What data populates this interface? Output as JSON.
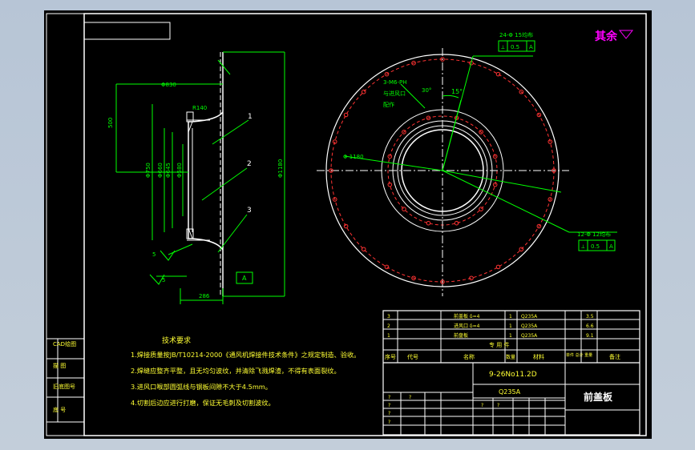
{
  "colors": {
    "background": "#b9c6d6",
    "paper": "#000000",
    "line": "#ffffff",
    "dimension": "#00ff00",
    "hole_red": "#ff3333",
    "title_text": "#ff00ff",
    "note_text": "#ffff00",
    "table_text": "#ffff33"
  },
  "drawing": {
    "roughness_corner": "其余",
    "flatness_callout_top": "24-Φ 15均布",
    "flatness_frame_top": [
      "⟂",
      "0.5",
      "A"
    ],
    "hole_callout": "3-M6-PH",
    "hole_callout_line2": "与进风口",
    "hole_callout_line3": "配作",
    "angle_label": "15°",
    "angle_label2": "30°",
    "circle_dim": "Φ 1180",
    "bottom_callout": "12-Φ 12均布",
    "bottom_frame": [
      "⟂",
      "0.5",
      "A"
    ]
  },
  "section_view": {
    "dims": {
      "d1": "Φ830",
      "d2": "R140",
      "d3": "500",
      "d4": "Φ750",
      "d5": "Φ660",
      "d6": "Φ645",
      "d7": "Φ580",
      "d8": "Φ1180",
      "d9": "5",
      "d10": "5",
      "d11": "286"
    },
    "balloons": [
      "1",
      "2",
      "3"
    ],
    "datum": "A"
  },
  "tech_notes": {
    "heading": "技术要求",
    "lines": [
      "1.焊接质量按JB/T10214-2000《通风机焊接件技术条件》之规定制造、验收。",
      "2.焊缝应整齐平整，且无均匀波纹，并清除飞溅焊渣，不得有表面裂纹。",
      "3.进风口喉部圆弧线与钢板间隙不大于4.5mm。",
      "4.切割后边应进行打磨，保证无毛刺及切割波纹。"
    ]
  },
  "parts_table": {
    "rows": [
      {
        "no": "3",
        "name": "前盖板 δ=4",
        "qty": "1",
        "mat": "Q235A",
        "w": "3.5"
      },
      {
        "no": "2",
        "name": "进风口 δ=4",
        "qty": "1",
        "mat": "Q235A",
        "w": "6.6"
      },
      {
        "no": "1",
        "name": "前盘板",
        "qty": "1",
        "mat": "Q235A",
        "w": "9.1"
      }
    ],
    "header_cols": [
      "序号",
      "代号",
      "名称",
      "数量",
      "材料",
      "单件 总计 重量",
      "备注"
    ],
    "header_top": "专 用 件",
    "drawing_no": "9-26No11.2D",
    "material": "Q235A",
    "part_title": "前盖板",
    "blank_cells": [
      "?",
      "?",
      "?",
      "?",
      "?",
      "?",
      "?"
    ]
  },
  "left_strip": {
    "labels": [
      "CAD绘图",
      "描 图",
      "旧底图号",
      "底 号"
    ]
  }
}
